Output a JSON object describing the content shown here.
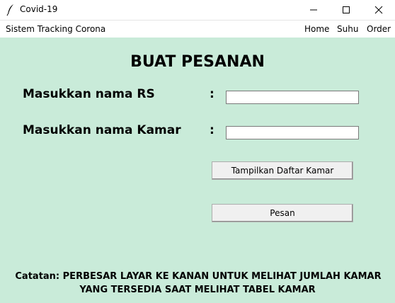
{
  "window": {
    "title": "Covid-19",
    "icons": {
      "app": "feather-icon",
      "minimize": "minimize-icon",
      "maximize": "maximize-icon",
      "close": "close-icon"
    }
  },
  "menubar": {
    "brand": "Sistem Tracking Corona",
    "items": [
      {
        "label": "Home"
      },
      {
        "label": "Suhu"
      },
      {
        "label": "Order"
      }
    ]
  },
  "form": {
    "heading": "BUAT PESANAN",
    "rs_label": "Masukkan nama RS",
    "kamar_label": "Masukkan nama Kamar",
    "separator": ":",
    "rs_value": "",
    "kamar_value": "",
    "tampilkan_button": "Tampilkan Daftar Kamar",
    "pesan_button": "Pesan"
  },
  "note": {
    "line1": "Catatan: PERBESAR LAYAR KE KANAN UNTUK MELIHAT JUMLAH KAMAR",
    "line2": "YANG TERSEDIA SAAT MELIHAT TABEL KAMAR"
  },
  "colors": {
    "background": "#c9ebd9",
    "button": "#f0f0f0"
  }
}
